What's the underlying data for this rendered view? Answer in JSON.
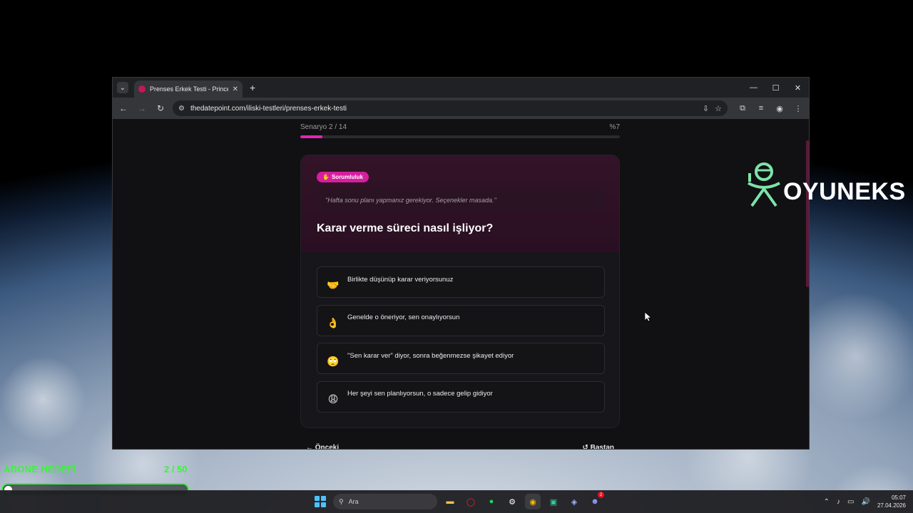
{
  "browser": {
    "tab_title": "Prenses Erkek Testi - Princess M",
    "url": "thedatepoint.com/iliski-testleri/prenses-erkek-testi"
  },
  "quiz": {
    "scenario_label": "Senaryo 2 / 14",
    "percent_label": "%7",
    "progress_fraction": 0.07,
    "category": "Sorumluluk",
    "scenario_text": "\"Hafta sonu planı yapmanız gerekiyor. Seçenekler masada.\"",
    "question": "Karar verme süreci nasıl işliyor?",
    "options": [
      {
        "emoji": "🤝",
        "text": "Birlikte düşünüp karar veriyorsunuz"
      },
      {
        "emoji": "👌",
        "text": "Genelde o öneriyor, sen onaylıyorsun"
      },
      {
        "emoji": "🙄",
        "text": "\"Sen karar ver\" diyor, sonra beğenmezse şikayet ediyor"
      },
      {
        "emoji": "😩",
        "text": "Her şeyi sen planlıyorsun, o sadece gelip gidiyor"
      }
    ],
    "prev_label": "Önceki",
    "restart_label": "Baştan"
  },
  "overlay": {
    "brand": "OYUNEKS",
    "goal_label": "ABONE HEDEFİ",
    "goal_count": "2 / 50",
    "goal_fraction": 0.04
  },
  "taskbar": {
    "search_placeholder": "Ara",
    "time": "05:07",
    "date": "27.04.2026",
    "discord_badge": "2"
  },
  "colors": {
    "accent": "#e026b8",
    "goal_green": "#3df23d",
    "brand_green": "#7de3a8"
  }
}
